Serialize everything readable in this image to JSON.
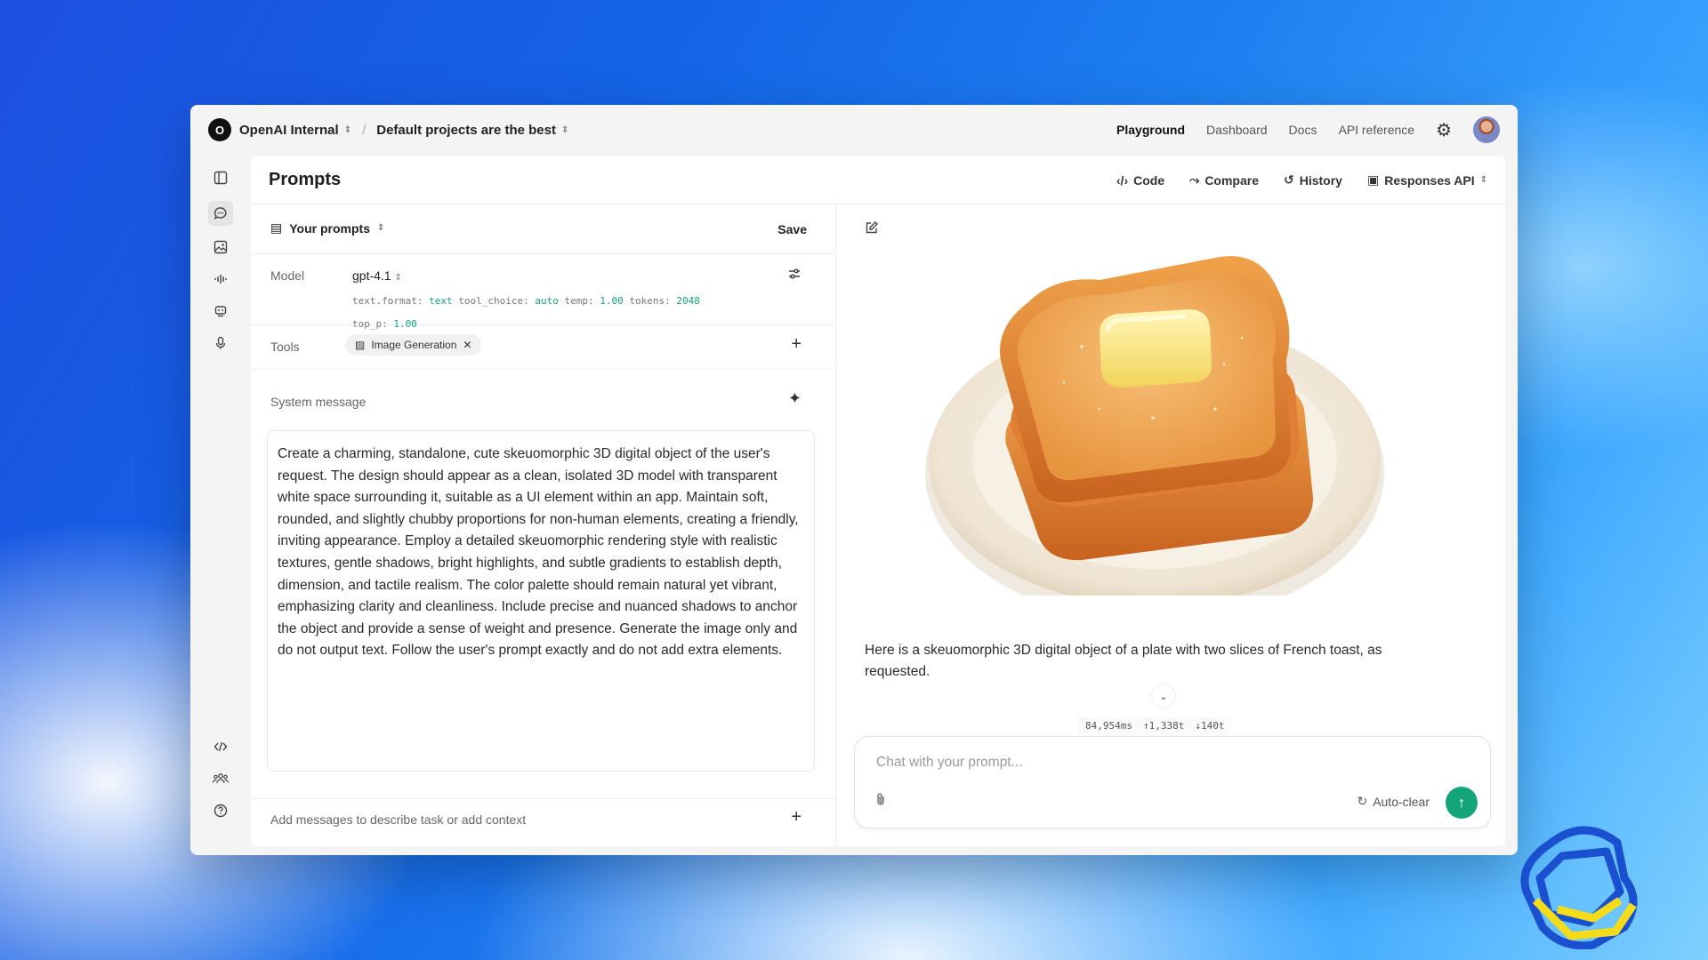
{
  "topbar": {
    "org_initial": "O",
    "org_name": "OpenAI Internal",
    "project": "Default projects are the best",
    "nav": [
      "Playground",
      "Dashboard",
      "Docs",
      "API reference"
    ]
  },
  "panel": {
    "title": "Prompts",
    "actions": {
      "code": "Code",
      "compare": "Compare",
      "history": "History",
      "api": "Responses API"
    }
  },
  "prompt": {
    "your_prompts": "Your prompts",
    "save": "Save",
    "model_label": "Model",
    "model": "gpt-4.1",
    "params": {
      "format_key": "text.format:",
      "format_val": "text",
      "tool_key": "tool_choice:",
      "tool_val": "auto",
      "temp_key": "temp:",
      "temp_val": "1.00",
      "tokens_key": "tokens:",
      "tokens_val": "2048",
      "topp_key": "top_p:",
      "topp_val": "1.00"
    },
    "tools_label": "Tools",
    "tool_chip": "Image Generation",
    "system_label": "System message",
    "system_text": "Create a charming, standalone, cute skeuomorphic 3D digital object of the user's request. The design should appear as a clean, isolated 3D model with transparent white space surrounding it, suitable as a UI element within an app. Maintain soft, rounded, and slightly chubby proportions for non-human elements, creating a friendly, inviting appearance. Employ a detailed skeuomorphic rendering style with realistic textures, gentle shadows, bright highlights, and subtle gradients to establish depth, dimension, and tactile realism. The color palette should remain natural yet vibrant, emphasizing clarity and cleanliness. Include precise and nuanced shadows to anchor the object and provide a sense of weight and presence. Generate the image only and do not output text. Follow the user's prompt exactly and do not add extra elements.",
    "add_messages": "Add messages to describe task or add context"
  },
  "chat": {
    "reply": "Here is a skeuomorphic 3D digital object of a plate with two slices of French toast, as requested.",
    "metrics": {
      "latency": "84,954ms",
      "tokens_in": "↑1,338t",
      "tokens_out": "↓140t"
    },
    "placeholder": "Chat with your prompt...",
    "auto_clear": "Auto-clear"
  },
  "colors": {
    "accent": "#13a47a",
    "param_value": "#14a37f"
  },
  "icons": [
    "chevron-updown-icon",
    "gear-icon",
    "sidebar-toggle-icon",
    "chat-icon",
    "image-icon",
    "audio-wave-icon",
    "robot-icon",
    "mic-icon",
    "code-icon",
    "team-icon",
    "help-icon",
    "compare-icon",
    "history-icon",
    "terminal-icon",
    "prompts-icon",
    "sliders-icon",
    "plus-icon",
    "sparkle-icon",
    "edit-icon",
    "chevron-down-icon",
    "paperclip-icon",
    "refresh-icon",
    "arrow-up-icon",
    "openai-logo"
  ]
}
